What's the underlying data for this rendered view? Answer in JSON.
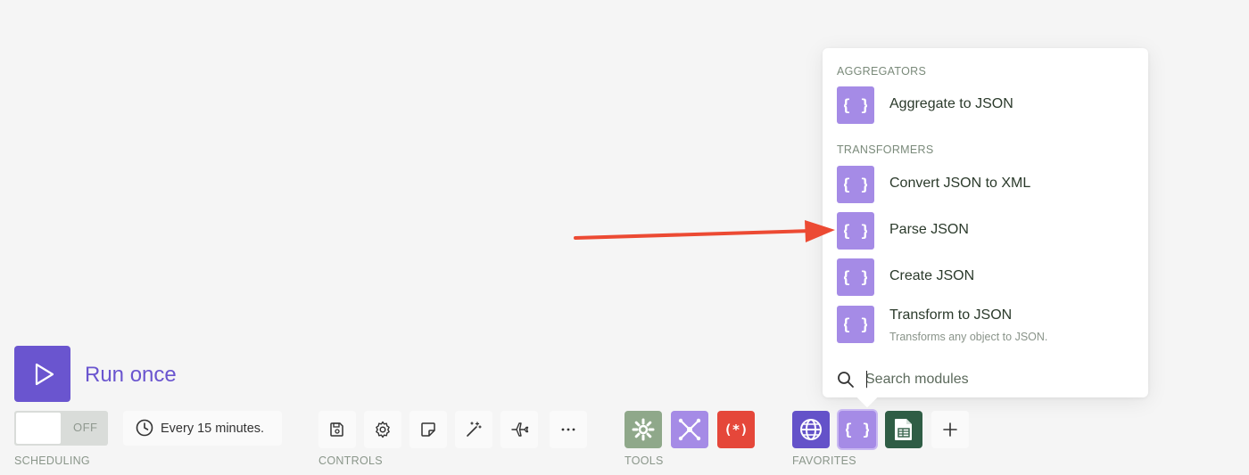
{
  "dropdown": {
    "sections": [
      {
        "label": "AGGREGATORS"
      },
      {
        "label": "TRANSFORMERS"
      }
    ],
    "modules": [
      {
        "title": "Aggregate to JSON",
        "icon": "json-braces-icon"
      },
      {
        "title": "Convert JSON to XML",
        "icon": "json-braces-icon"
      },
      {
        "title": "Parse JSON",
        "icon": "json-braces-icon"
      },
      {
        "title": "Create JSON",
        "icon": "json-braces-icon"
      },
      {
        "title": "Transform to JSON",
        "description": "Transforms any object to JSON.",
        "icon": "json-braces-icon"
      }
    ],
    "search": {
      "placeholder": "Search modules",
      "value": ""
    },
    "module_icon_color": "#a58be6"
  },
  "run": {
    "label": "Run once",
    "color": "#6a55cf"
  },
  "scheduling": {
    "toggle_state": "OFF",
    "interval_text": "Every 15 minutes.",
    "group_label": "SCHEDULING"
  },
  "controls": {
    "group_label": "CONTROLS",
    "buttons": [
      "save-icon",
      "settings-gear-icon",
      "notes-icon",
      "magic-wand-icon",
      "airplane-icon",
      "more-dots-icon"
    ]
  },
  "tools": {
    "group_label": "TOOLS",
    "buttons": [
      {
        "icon": "gear-tools-icon",
        "color": "#8fa88a"
      },
      {
        "icon": "flow-control-icon",
        "color": "#a58be6"
      },
      {
        "icon": "text-parser-icon",
        "color": "#e5473a"
      }
    ]
  },
  "favorites": {
    "group_label": "FAVORITES",
    "buttons": [
      {
        "icon": "http-globe-icon",
        "color": "#6452c9"
      },
      {
        "icon": "json-braces-icon",
        "color": "#a58be6"
      },
      {
        "icon": "google-sheets-icon",
        "color": "#2f5d45"
      },
      {
        "icon": "plus-icon",
        "color": "#fafafa"
      }
    ]
  },
  "annotation": {
    "arrow_color": "#ec4a33",
    "target": "Parse JSON"
  }
}
